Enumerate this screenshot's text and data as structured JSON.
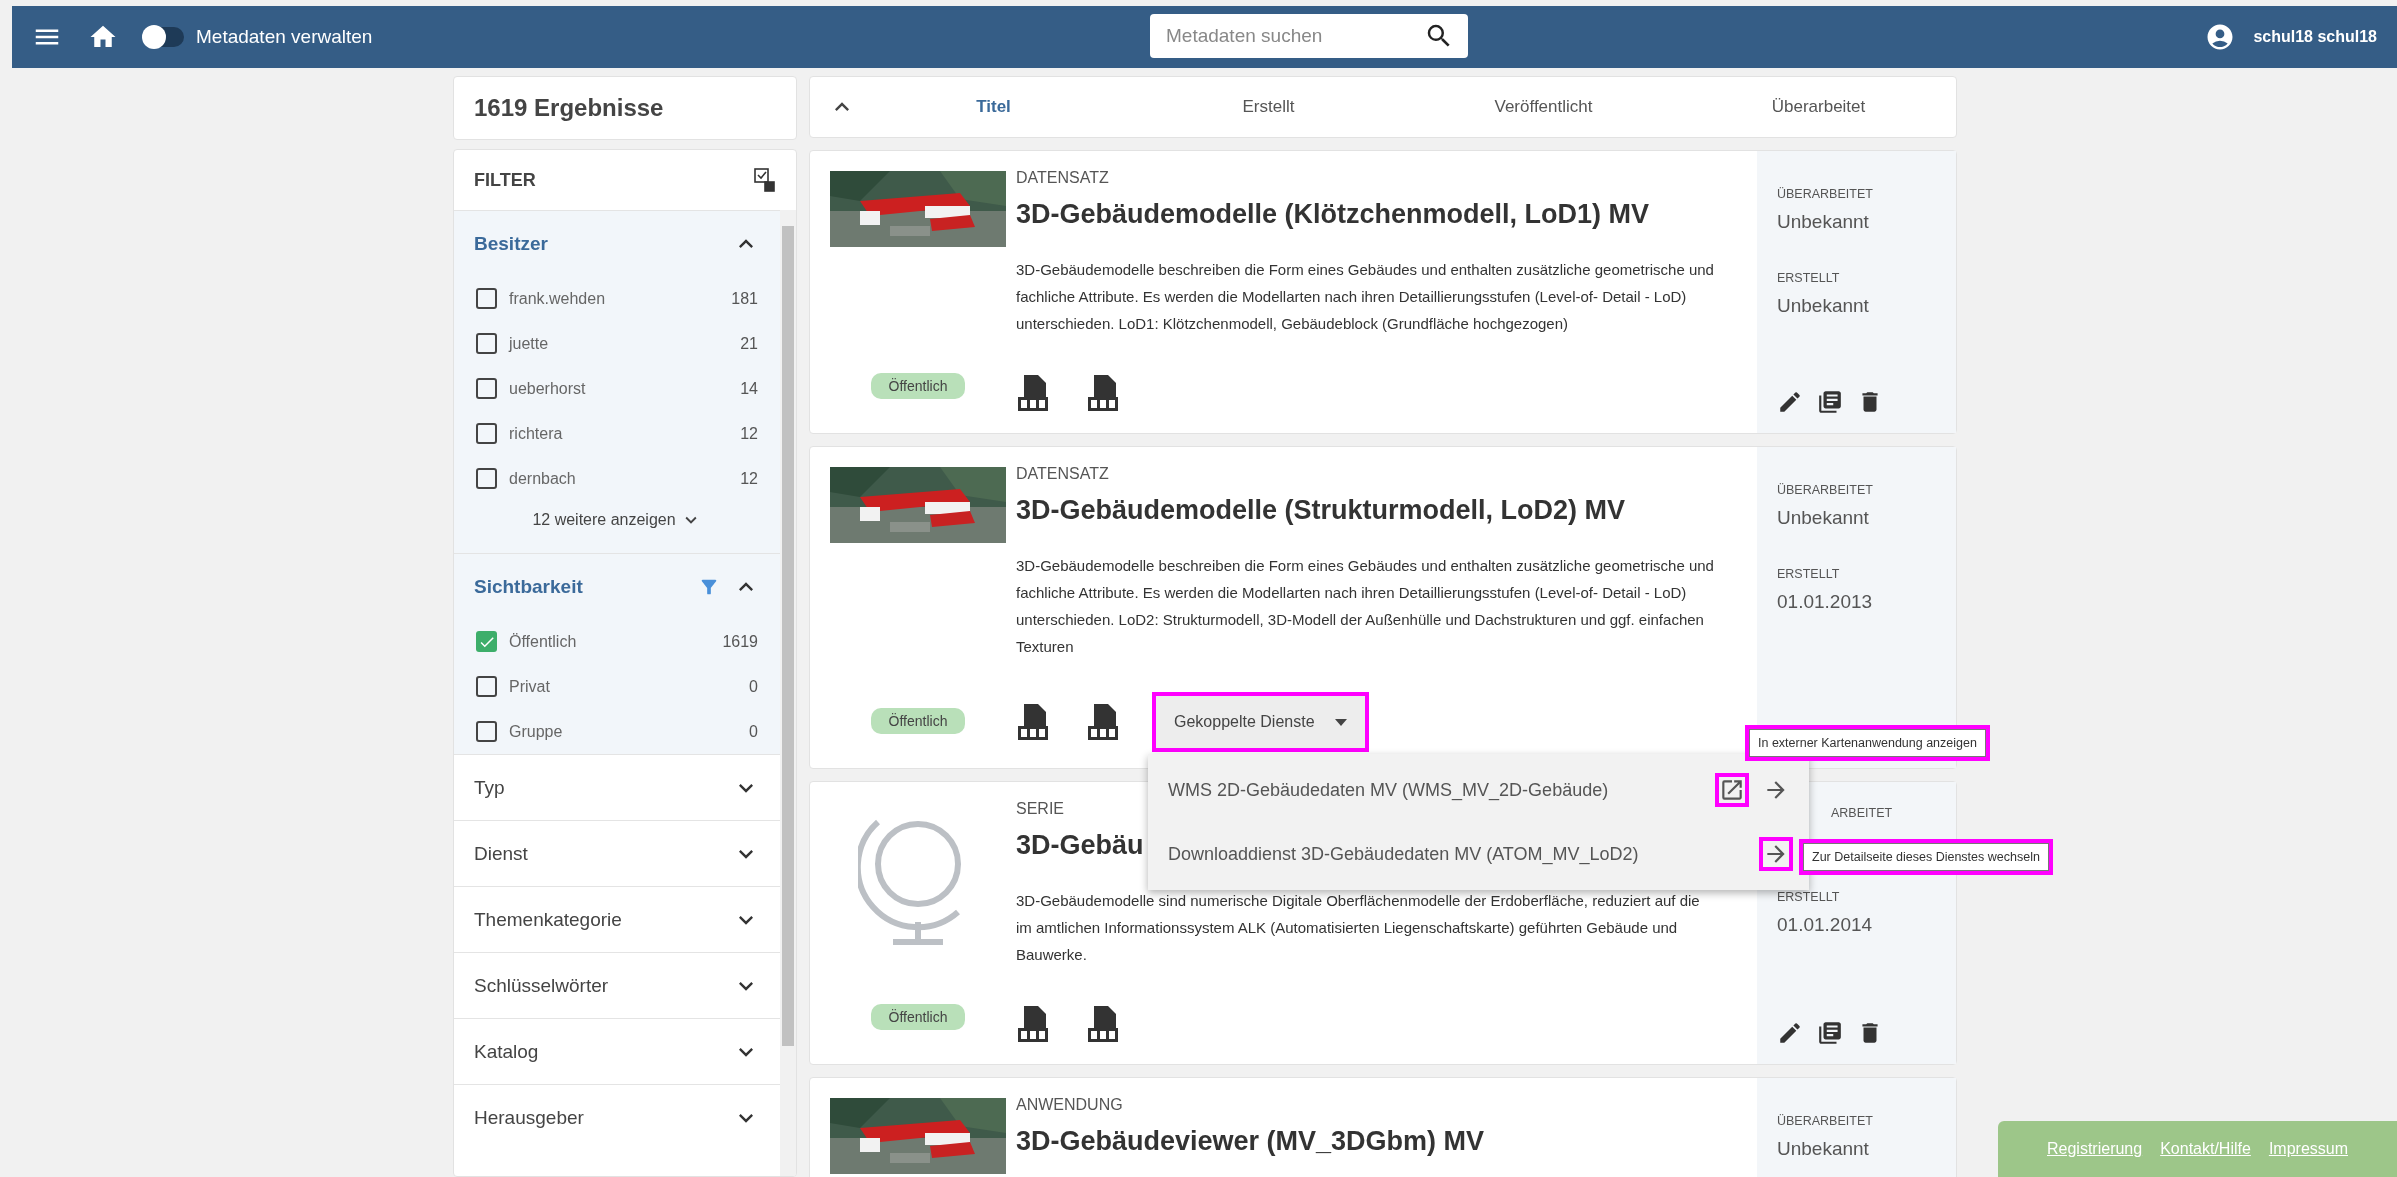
{
  "topbar": {
    "toggle": {
      "label": "Metadaten verwalten",
      "on": false
    },
    "search": {
      "placeholder": "Metadaten suchen"
    },
    "user": "schul18 schul18"
  },
  "results": {
    "count": "1619",
    "label": "Ergebnisse"
  },
  "filter": {
    "title": "FILTER",
    "sections": [
      {
        "title": "Besitzer",
        "expanded": true,
        "active": false,
        "options": [
          {
            "label": "frank.wehden",
            "count": "181",
            "checked": false
          },
          {
            "label": "juette",
            "count": "21",
            "checked": false
          },
          {
            "label": "ueberhorst",
            "count": "14",
            "checked": false
          },
          {
            "label": "richtera",
            "count": "12",
            "checked": false
          },
          {
            "label": "dernbach",
            "count": "12",
            "checked": false
          }
        ],
        "more": "12 weitere anzeigen"
      },
      {
        "title": "Sichtbarkeit",
        "expanded": true,
        "active": true,
        "options": [
          {
            "label": "Öffentlich",
            "count": "1619",
            "checked": true
          },
          {
            "label": "Privat",
            "count": "0",
            "checked": false
          },
          {
            "label": "Gruppe",
            "count": "0",
            "checked": false
          }
        ]
      },
      {
        "title": "Typ",
        "expanded": false,
        "active": false
      },
      {
        "title": "Dienst",
        "expanded": false,
        "active": false
      },
      {
        "title": "Themenkategorie",
        "expanded": false,
        "active": false
      },
      {
        "title": "Schlüsselwörter",
        "expanded": false,
        "active": false
      },
      {
        "title": "Katalog",
        "expanded": false,
        "active": false
      },
      {
        "title": "Herausgeber",
        "expanded": false,
        "active": false
      }
    ]
  },
  "sort": {
    "columns": [
      {
        "label": "Titel",
        "selected": true
      },
      {
        "label": "Erstellt",
        "selected": false
      },
      {
        "label": "Veröffentlicht",
        "selected": false
      },
      {
        "label": "Überarbeitet",
        "selected": false
      }
    ]
  },
  "cards": [
    {
      "type": "DATENSATZ",
      "kind": "picture",
      "title": "3D-Gebäudemodelle (Klötzchenmodell, LoD1) MV",
      "description": "3D-Gebäudemodelle beschreiben die Form eines Gebäudes und enthalten zusätzliche geometrische und fachliche Attribute. Es werden die Modellarten nach ihren Detaillierungsstufen (Level-of- Detail - LoD) unterschieden. LoD1: Klötzchenmodell, Gebäudeblock (Grundfläche hochgezogen)",
      "visibility": "Öffentlich",
      "meta": [
        {
          "label": "ÜBERARBEITET",
          "value": "Unbekannt"
        },
        {
          "label": "ERSTELLT",
          "value": "Unbekannt"
        }
      ],
      "actions": true
    },
    {
      "type": "DATENSATZ",
      "kind": "picture",
      "title": "3D-Gebäudemodelle (Strukturmodell, LoD2) MV",
      "description": "3D-Gebäudemodelle beschreiben die Form eines Gebäudes und enthalten zusätzliche geometrische und fachliche Attribute. Es werden die Modellarten nach ihren Detaillierungsstufen (Level-of- Detail - LoD) unterschieden. LoD2: Strukturmodell, 3D-Modell der Außenhülle und Dachstrukturen und ggf. einfachen Texturen",
      "visibility": "Öffentlich",
      "meta": [
        {
          "label": "ÜBERARBEITET",
          "value": "Unbekannt"
        },
        {
          "label": "ERSTELLT",
          "value": "01.01.2013"
        }
      ],
      "actions": false,
      "services": {
        "label": "Gekoppelte Dienste",
        "highlighted": true,
        "items": [
          {
            "label": "WMS 2D-Gebäudedaten MV (WMS_MV_2D-Gebäude)",
            "actions": [
              {
                "kind": "external",
                "highlighted": true,
                "tooltip": "In externer Kartenanwendung anzeigen"
              },
              {
                "kind": "detail",
                "highlighted": false
              }
            ]
          },
          {
            "label": "Downloaddienst 3D-Gebäudedaten MV (ATOM_MV_LoD2)",
            "actions": [
              {
                "kind": "detail",
                "highlighted": true,
                "tooltip": "Zur Detailseite dieses Dienstes wechseln"
              }
            ]
          }
        ]
      }
    },
    {
      "type": "SERIE",
      "kind": "globe",
      "title": "3D-Gebäu",
      "description": "3D-Gebäudemodelle sind numerische Digitale Oberflächenmodelle der Erdoberfläche, reduziert auf die im amtlichen Informationssystem ALK (Automatisierten Liegenschaftskarte) geführten Gebäude und Bauwerke.",
      "visibility": "Öffentlich",
      "meta": [
        {
          "label": "ARBEITET",
          "covered": true
        },
        {
          "label": "ERSTELLT",
          "value": "01.01.2014"
        }
      ],
      "actions": true
    },
    {
      "type": "ANWENDUNG",
      "kind": "picture",
      "title": "3D-Gebäudeviewer (MV_3DGbm) MV",
      "meta": [
        {
          "label": "ÜBERARBEITET",
          "value": "Unbekannt"
        }
      ]
    }
  ],
  "footer": {
    "links": [
      "Registrierung",
      "Kontakt/Hilfe",
      "Impressum"
    ]
  }
}
